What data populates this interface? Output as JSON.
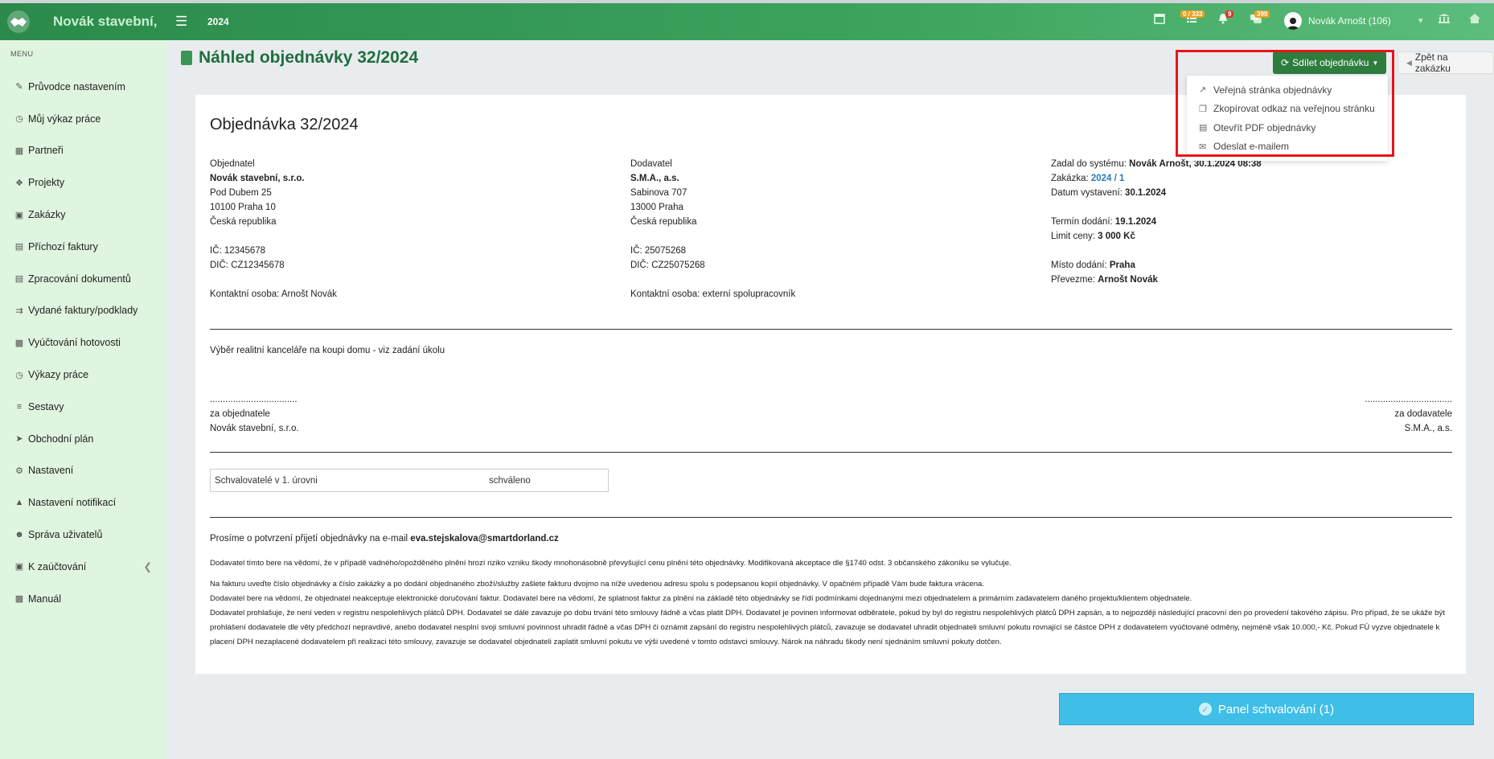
{
  "topbar": {
    "brand": "Novák stavební,",
    "year": "2024",
    "badges": {
      "tasks": "0 / 333",
      "notifications": "9",
      "messages": "399"
    },
    "user_name": "Novák Arnošt (106)"
  },
  "sidebar": {
    "caption": "MENU",
    "items": [
      {
        "label": "Průvodce nastavením",
        "icon": "pencil-icon"
      },
      {
        "label": "Můj výkaz práce",
        "icon": "clock-icon"
      },
      {
        "label": "Partneři",
        "icon": "building-icon"
      },
      {
        "label": "Projekty",
        "icon": "cubes-icon"
      },
      {
        "label": "Zakázky",
        "icon": "box-icon"
      },
      {
        "label": "Příchozí faktury",
        "icon": "file-icon"
      },
      {
        "label": "Zpracování dokumentů",
        "icon": "file-icon"
      },
      {
        "label": "Vydané faktury/podklady",
        "icon": "file-export-icon"
      },
      {
        "label": "Vyúčtování hotovosti",
        "icon": "money-icon"
      },
      {
        "label": "Výkazy práce",
        "icon": "clock-icon"
      },
      {
        "label": "Sestavy",
        "icon": "chart-icon"
      },
      {
        "label": "Obchodní plán",
        "icon": "rocket-icon"
      },
      {
        "label": "Nastavení",
        "icon": "gears-icon"
      },
      {
        "label": "Nastavení notifikací",
        "icon": "bell-icon"
      },
      {
        "label": "Správa uživatelů",
        "icon": "users-icon"
      },
      {
        "label": "K zaúčtování",
        "icon": "folder-icon"
      },
      {
        "label": "Manuál",
        "icon": "book-icon"
      }
    ]
  },
  "page": {
    "title": "Náhled objednávky 32/2024",
    "share_label": "Sdílet objednávku",
    "back_label": "Zpět na zakázku",
    "dropdown": [
      "Veřejná stránka objednávky",
      "Zkopírovat odkaz na veřejnou stránku",
      "Otevřít PDF objednávky",
      "Odeslat e-mailem"
    ]
  },
  "order": {
    "heading": "Objednávka 32/2024",
    "buyer": {
      "label": "Objednatel",
      "name": "Novák stavební, s.r.o.",
      "street": "Pod Dubem 25",
      "city": "10100 Praha 10",
      "country": "Česká republika",
      "ic": "IČ: 12345678",
      "dic": "DIČ: CZ12345678",
      "contact": "Kontaktní osoba: Arnošt Novák"
    },
    "supplier": {
      "label": "Dodavatel",
      "name": "S.M.A., a.s.",
      "street": "Sabinova 707",
      "city": "13000 Praha",
      "country": "Česká republika",
      "ic": "IČ: 25075268",
      "dic": "DIČ: CZ25075268",
      "contact": "Kontaktní osoba: externí spolupracovník"
    },
    "meta": {
      "entered_label": "Zadal do systému: ",
      "entered_value": "Novák Arnošt, 30.1.2024 08:38",
      "job_label": "Zakázka: ",
      "job_value": "2024 / 1",
      "issued_label": "Datum vystavení: ",
      "issued_value": "30.1.2024",
      "delivery_label": "Termín dodání: ",
      "delivery_value": "19.1.2024",
      "price_label": "Limit ceny: ",
      "price_value": "3 000 Kč",
      "place_label": "Místo dodání: ",
      "place_value": "Praha",
      "receiver_label": "Převezme: ",
      "receiver_value": "Arnošt Novák"
    },
    "description": "Výběr realitní kanceláře na koupi domu - viz zadání úkolu",
    "sign_left": {
      "dots": "..................................",
      "label": "za objednatele",
      "name": "Novák stavební, s.r.o."
    },
    "sign_right": {
      "dots": "..................................",
      "label": "za dodavatele",
      "name": "S.M.A., a.s."
    },
    "approval": {
      "label": "Schvalovatelé v 1. úrovni",
      "status": "schváleno"
    },
    "confirm_text": "Prosíme o potvrzení přijetí objednávky na e-mail ",
    "confirm_email": "eva.stejskalova@smartdorland.cz",
    "legal1": "Dodavatel tímto bere na vědomí, že v případě vadného/opožděného plnění hrozí riziko vzniku škody mnohonásobně převyšující cenu plnění této objednávky. Modifikovaná akceptace dle §1740 odst. 3 občanského zákoníku se vylučuje.",
    "legal2": "Na fakturu uveďte číslo objednávky a číslo zakázky a po dodání objednaného zboží/služby zašlete fakturu dvojmo na níže uvedenou adresu spolu s podepsanou kopií objednávky. V opačném případě Vám bude faktura vrácena.",
    "legal3": "Dodavatel bere na vědomí, že objednatel neakceptuje elektronické doručování faktur. Dodavatel bere na vědomí, že splatnost faktur za plnění na základě této objednávky se řídí podmínkami dojednanými mezi objednatelem a primárním zadavatelem daného projektu/klientem objednatele.",
    "legal4": "Dodavatel prohlašuje, že není veden v registru nespolehlivých plátců DPH. Dodavatel se dále zavazuje po dobu trvání této smlouvy řádně a včas platit DPH. Dodavatel je povinen informovat odběratele, pokud by byl do registru nespolehlivých plátců DPH zapsán, a to nejpozději následující pracovní den po provedení takového zápisu. Pro případ, že se ukáže být prohlášení dodavatele dle věty předchozí nepravdivé, anebo dodavatel nesplní svoji smluvní povinnost uhradit řádně a včas DPH či oznámit zapsání do registru nespolehlivých plátců, zavazuje se dodavatel uhradit objednateli smluvní pokutu rovnající se částce DPH z dodavatelem vyúčtované odměny, nejméně však 10.000,- Kč. Pokud FÚ vyzve objednatele k placení DPH nezaplacené dodavatelem při realizaci této smlouvy, zavazuje se dodavatel objednateli zaplatit smluvní pokutu ve výši uvedené v tomto odstavci smlouvy. Nárok na náhradu škody není sjednáním smluvní pokuty dotčen."
  },
  "panel": {
    "label": "Panel schvalování  (1)"
  }
}
